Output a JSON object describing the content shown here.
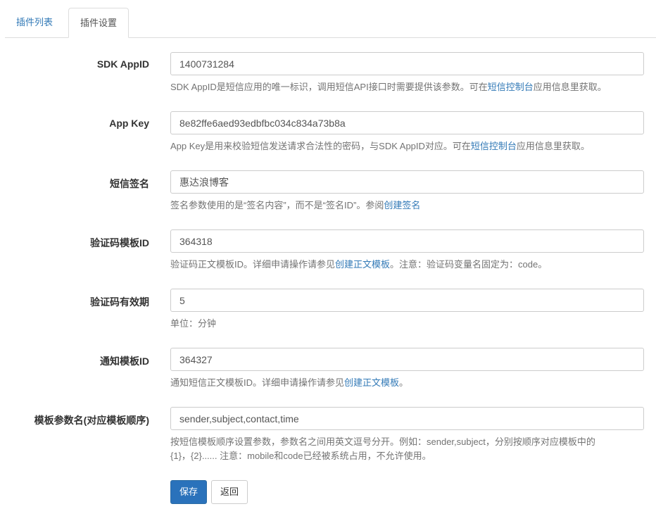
{
  "tabs": [
    {
      "label": "插件列表",
      "active": false
    },
    {
      "label": "插件设置",
      "active": true
    }
  ],
  "form": {
    "sdk_appid": {
      "label": "SDK AppID",
      "value": "1400731284",
      "help_pre": "SDK AppID是短信应用的唯一标识，调用短信API接口时需要提供该参数。可在",
      "help_link": "短信控制台",
      "help_post": "应用信息里获取。"
    },
    "app_key": {
      "label": "App Key",
      "value": "8e82ffe6aed93edbfbc034c834a73b8a",
      "help_pre": "App Key是用来校验短信发送请求合法性的密码，与SDK AppID对应。可在",
      "help_link": "短信控制台",
      "help_post": "应用信息里获取。"
    },
    "sign": {
      "label": "短信签名",
      "value": "惠达浪博客",
      "help_pre": "签名参数使用的是“签名内容”，而不是“签名ID”。参阅",
      "help_link": "创建签名",
      "help_post": ""
    },
    "code_template": {
      "label": "验证码模板ID",
      "value": "364318",
      "help_pre": "验证码正文模板ID。详细申请操作请参见",
      "help_link": "创建正文模板",
      "help_post": "。注意：验证码变量名固定为：code。"
    },
    "code_expire": {
      "label": "验证码有效期",
      "value": "5",
      "help": "单位：分钟"
    },
    "notify_template": {
      "label": "通知模板ID",
      "value": "364327",
      "help_pre": "通知短信正文模板ID。详细申请操作请参见",
      "help_link": "创建正文模板",
      "help_post": "。"
    },
    "template_params": {
      "label": "模板参数名(对应模板顺序)",
      "value": "sender,subject,contact,time",
      "help_line1": "按短信模板顺序设置参数，参数名之间用英文逗号分开。例如：sender,subject，分别按顺序对应模板中的",
      "help_line2": "{1}，{2}...... 注意：mobile和code已经被系统占用，不允许使用。"
    }
  },
  "buttons": {
    "save": "保存",
    "back": "返回"
  },
  "colors": {
    "primary": "#2a72bb",
    "link": "#337ab7",
    "help_text": "#737373",
    "border": "#cccccc"
  }
}
